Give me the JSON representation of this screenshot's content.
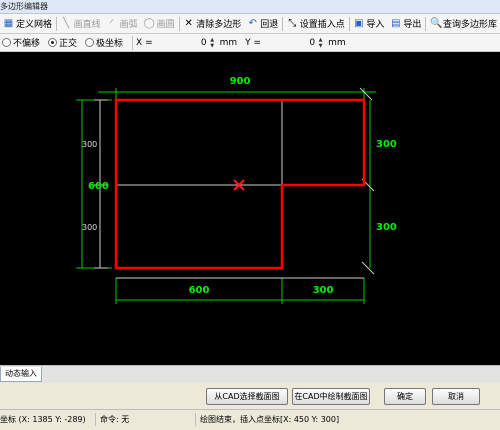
{
  "window": {
    "title": "多边形编辑器"
  },
  "toolbar": {
    "define_grid": "定义网格",
    "draw_line": "画直线",
    "draw_arc": "画弧",
    "draw_circle": "画圆",
    "clear_polygon": "清除多边形",
    "undo": "回退",
    "set_insert_point": "设置插入点",
    "import": "导入",
    "export": "导出",
    "query_library": "查询多边形库"
  },
  "options": {
    "modes": [
      {
        "label": "不偏移",
        "selected": false
      },
      {
        "label": "正交",
        "selected": true
      },
      {
        "label": "极坐标",
        "selected": false
      }
    ],
    "x_label": "X =",
    "x_value": "0",
    "y_label": "Y =",
    "y_value": "0",
    "unit": "mm"
  },
  "drawing": {
    "dim_top": "900",
    "dim_left_total": "600",
    "dim_left_upper": "300",
    "dim_left_lower": "300",
    "dim_right_upper": "300",
    "dim_right_lower": "300",
    "dim_bottom_left": "600",
    "dim_bottom_right": "300",
    "colors": {
      "shape": "#ff0000",
      "dimension": "#00ee00",
      "background": "#000000"
    }
  },
  "tabs": {
    "dynamic_input": "动态输入"
  },
  "actions": {
    "select_from_cad": "从CAD选择截面图",
    "draw_in_cad": "在CAD中绘制截面图",
    "confirm": "确定",
    "cancel": "取消"
  },
  "status": {
    "coord": "坐标 (X: 1385 Y: -289)",
    "command": "命令: 无",
    "message": "绘图结束，插入点坐标[X: 450 Y: 300]"
  }
}
